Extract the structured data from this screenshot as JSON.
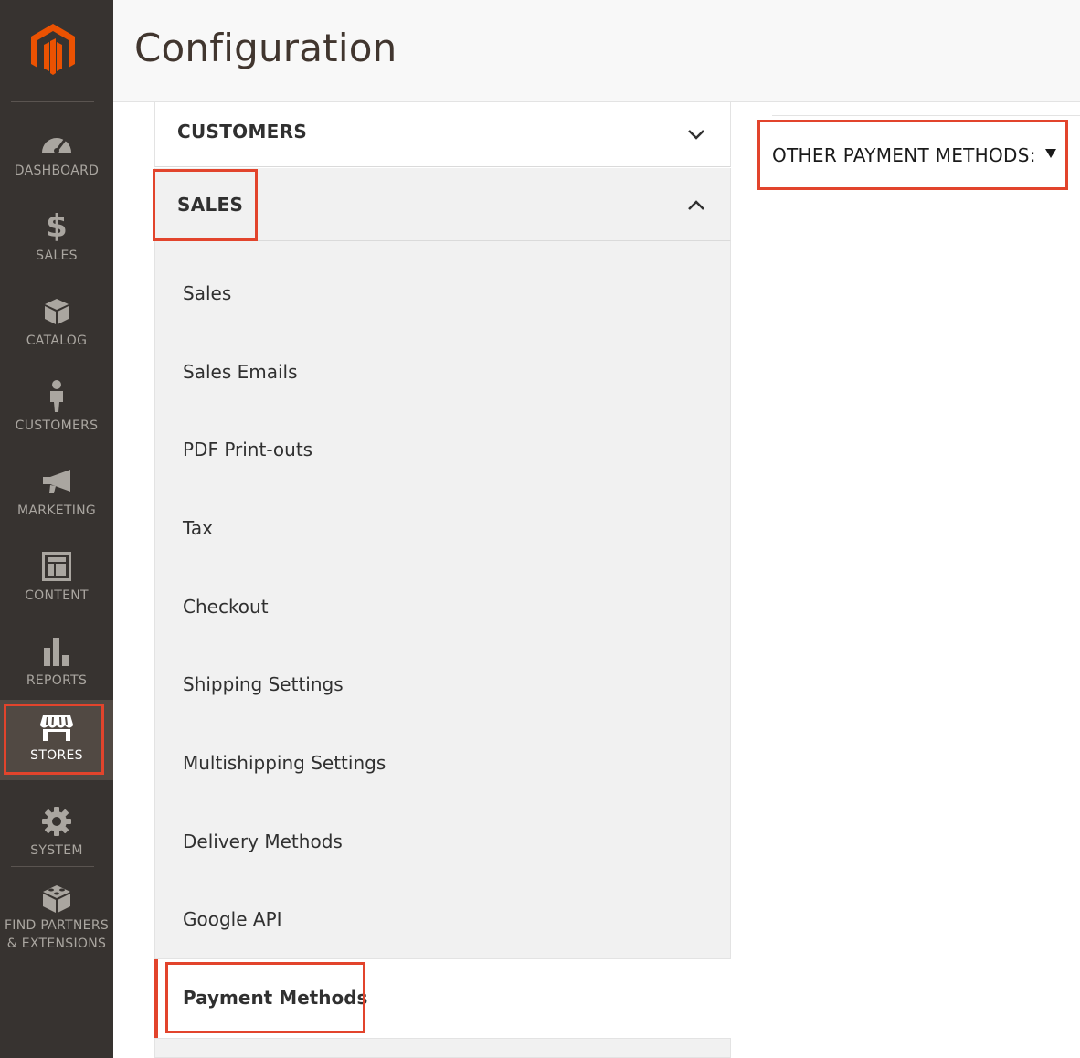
{
  "header": {
    "title": "Configuration"
  },
  "sidebar": {
    "items": [
      {
        "id": "dashboard",
        "label": "DASHBOARD",
        "icon": "gauge-icon"
      },
      {
        "id": "sales",
        "label": "SALES",
        "icon": "dollar-icon"
      },
      {
        "id": "catalog",
        "label": "CATALOG",
        "icon": "box-icon"
      },
      {
        "id": "customers",
        "label": "CUSTOMERS",
        "icon": "person-icon"
      },
      {
        "id": "marketing",
        "label": "MARKETING",
        "icon": "megaphone-icon"
      },
      {
        "id": "content",
        "label": "CONTENT",
        "icon": "layout-icon"
      },
      {
        "id": "reports",
        "label": "REPORTS",
        "icon": "bar-chart-icon"
      },
      {
        "id": "stores",
        "label": "STORES",
        "icon": "storefront-icon",
        "active": true
      },
      {
        "id": "system",
        "label": "SYSTEM",
        "icon": "gear-icon"
      },
      {
        "id": "partners",
        "label_line1": "FIND PARTNERS",
        "label_line2": "& EXTENSIONS",
        "icon": "blocks-icon"
      }
    ]
  },
  "config": {
    "sections": [
      {
        "label": "CUSTOMERS",
        "state": "collapsed"
      },
      {
        "label": "SALES",
        "state": "expanded"
      }
    ],
    "sales_items": [
      "Sales",
      "Sales Emails",
      "PDF Print-outs",
      "Tax",
      "Checkout",
      "Shipping Settings",
      "Multishipping Settings",
      "Delivery Methods",
      "Google API",
      "Payment Methods"
    ],
    "active_item": "Payment Methods"
  },
  "main": {
    "other_payment_methods": "OTHER PAYMENT METHODS:"
  },
  "colors": {
    "sidebar_bg": "#373330",
    "highlight": "#e2442c",
    "logo": "#eb5202"
  }
}
